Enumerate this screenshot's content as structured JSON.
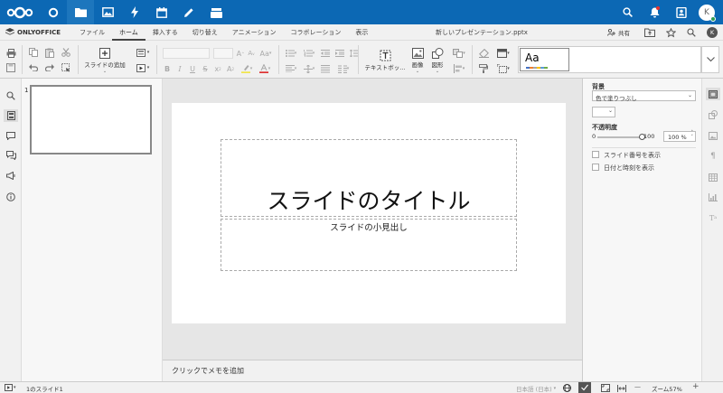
{
  "topbar": {
    "apps": [
      "dashboard",
      "files",
      "photos",
      "activity",
      "calendar",
      "notes",
      "deck"
    ],
    "avatar_initial": "K"
  },
  "menubar": {
    "brand": "ONLYOFFICE",
    "tabs": [
      "ファイル",
      "ホーム",
      "挿入する",
      "切り替え",
      "アニメーション",
      "コラボレーション",
      "表示"
    ],
    "active_tab": "ホーム",
    "doc_title": "新しいプレゼンテーション.pptx",
    "share_label": "共有",
    "user_initial": "K"
  },
  "toolbar": {
    "add_slide_label": "スライドの追加",
    "textbox_label": "テキストボッ...",
    "image_label": "画像",
    "shape_label": "図形",
    "theme_preview_text": "Aa"
  },
  "thumbnails": {
    "slide_number": "1"
  },
  "slide": {
    "title": "スライドのタイトル",
    "subtitle": "スライドの小見出し"
  },
  "notes": {
    "placeholder": "クリックでメモを追加"
  },
  "right_panel": {
    "background_label": "背景",
    "fill_value": "色で塗りつぶし",
    "opacity_label": "不透明度",
    "slider_min": "0",
    "slider_max": "100",
    "opacity_value": "100 %",
    "opacity_fraction": 1.0,
    "show_slide_number": "スライド番号を表示",
    "show_datetime": "日付と時刻を表示"
  },
  "statusbar": {
    "slide_count": "1のスライド1",
    "language": "日本語 (日本)",
    "zoom": "ズーム57%",
    "zoom_minus": "—",
    "zoom_plus": "+"
  },
  "colors": {
    "nextcloud_blue": "#0c68b4",
    "toolbar_bg": "#f1f1f1",
    "online_status": "#2d9d53"
  }
}
